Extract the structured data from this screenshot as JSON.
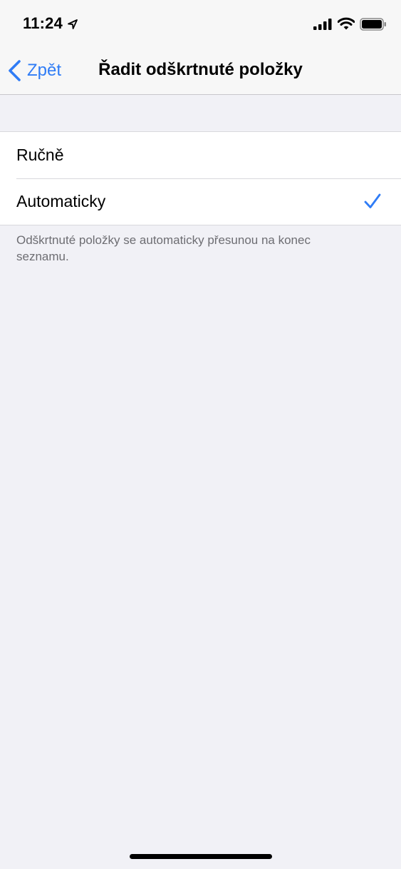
{
  "status_bar": {
    "time": "11:24"
  },
  "nav": {
    "back_label": "Zpět",
    "title": "Řadit odškrtnuté položky"
  },
  "options": [
    {
      "label": "Ručně",
      "selected": false
    },
    {
      "label": "Automaticky",
      "selected": true
    }
  ],
  "footer_note": "Odškrtnuté položky se automaticky přesunou na konec seznamu.",
  "colors": {
    "accent": "#2F7CF6",
    "background": "#F1F1F6",
    "cell": "#FFFFFF",
    "secondary_text": "#6D6D72"
  },
  "icons": [
    "location-arrow-icon",
    "cellular-signal-icon",
    "wifi-icon",
    "battery-icon",
    "chevron-left-icon",
    "checkmark-icon"
  ]
}
